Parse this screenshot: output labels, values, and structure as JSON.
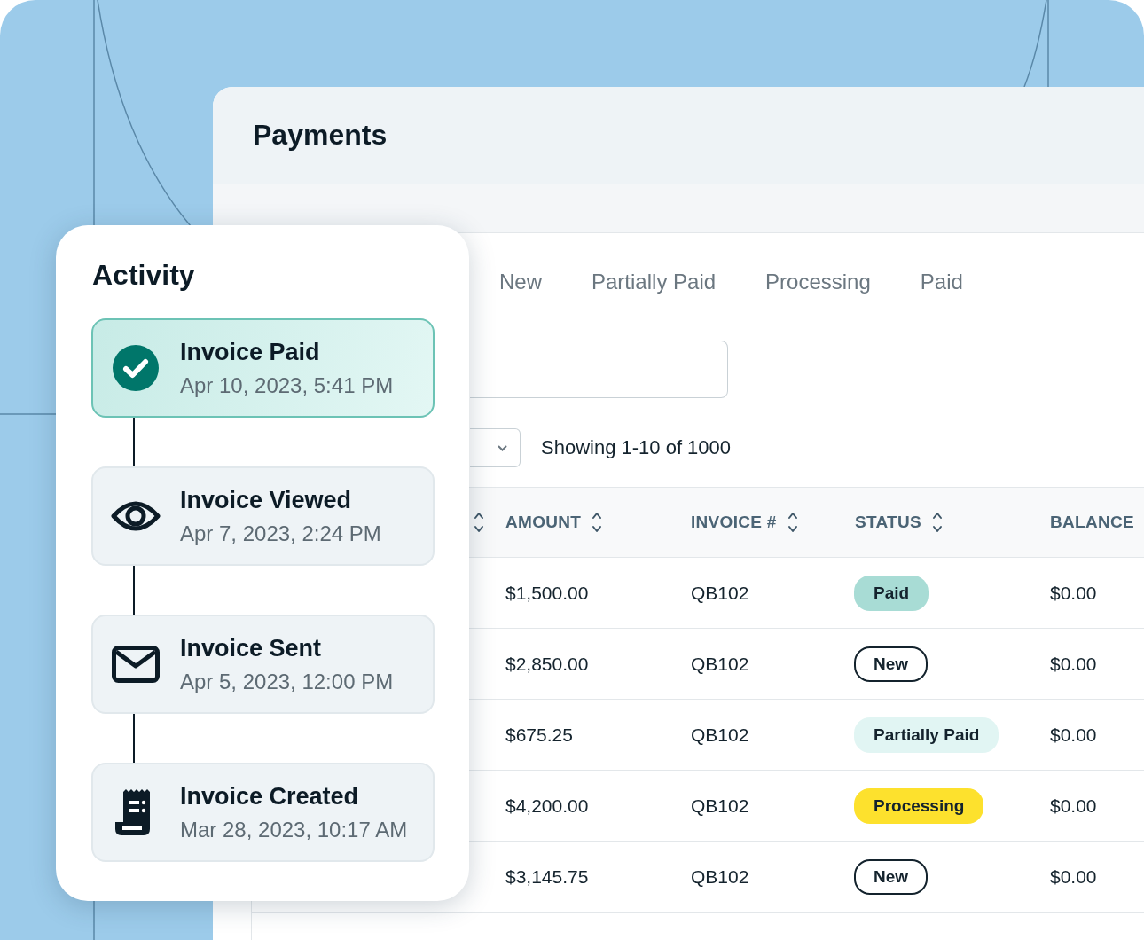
{
  "payments": {
    "title": "Payments",
    "tabs": [
      {
        "label": "New",
        "selected": false
      },
      {
        "label": "Partially Paid",
        "selected": false
      },
      {
        "label": "Processing",
        "selected": false
      },
      {
        "label": "Paid",
        "selected": false
      }
    ],
    "pagination": {
      "summary": "Showing 1-10 of 1000"
    },
    "table": {
      "columns": [
        {
          "label": "AMOUNT",
          "sortable": true
        },
        {
          "label": "INVOICE #",
          "sortable": true
        },
        {
          "label": "STATUS",
          "sortable": true
        },
        {
          "label": "BALANCE",
          "sortable": false
        }
      ],
      "rows": [
        {
          "amount": "$1,500.00",
          "invoice": "QB102",
          "status": {
            "label": "Paid",
            "kind": "paid"
          },
          "balance": "$0.00"
        },
        {
          "amount": "$2,850.00",
          "invoice": "QB102",
          "status": {
            "label": "New",
            "kind": "new"
          },
          "balance": "$0.00"
        },
        {
          "amount": "$675.25",
          "invoice": "QB102",
          "status": {
            "label": "Partially Paid",
            "kind": "partial"
          },
          "balance": "$0.00"
        },
        {
          "amount": "$4,200.00",
          "invoice": "QB102",
          "status": {
            "label": "Processing",
            "kind": "processing"
          },
          "balance": "$0.00"
        },
        {
          "amount": "$3,145.75",
          "invoice": "QB102",
          "status": {
            "label": "New",
            "kind": "new"
          },
          "balance": "$0.00"
        }
      ]
    }
  },
  "activity": {
    "title": "Activity",
    "events": [
      {
        "title": "Invoice Paid",
        "time": "Apr 10, 2023, 5:41 PM",
        "kind": "paid",
        "selected": true
      },
      {
        "title": "Invoice Viewed",
        "time": "Apr 7, 2023, 2:24 PM",
        "kind": "viewed",
        "selected": false
      },
      {
        "title": "Invoice Sent",
        "time": "Apr 5, 2023, 12:00 PM",
        "kind": "sent",
        "selected": false
      },
      {
        "title": "Invoice Created",
        "time": "Mar 28, 2023, 10:17 AM",
        "kind": "created",
        "selected": false
      }
    ]
  }
}
